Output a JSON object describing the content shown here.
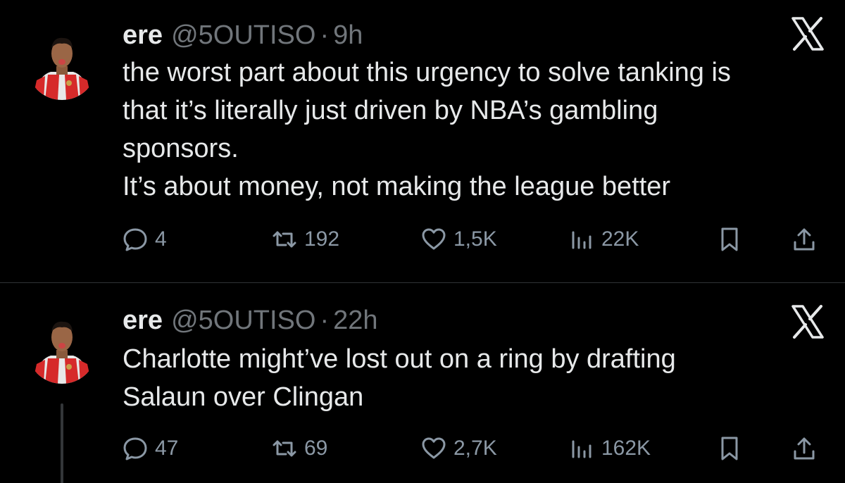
{
  "tweets": [
    {
      "author": {
        "name": "ere",
        "handle": "@5OUTISO",
        "avatar_icon": "avatar-football-player"
      },
      "separator": "·",
      "time": "9h",
      "platform_icon": "x-logo-icon",
      "text_lines": [
        "the worst part about this urgency to solve tanking is",
        "that it’s literally just driven by NBA’s gambling",
        "sponsors.",
        "It’s about money, not making the league better"
      ],
      "stats": {
        "replies": "4",
        "reposts": "192",
        "likes": "1,5K",
        "views": "22K"
      }
    },
    {
      "author": {
        "name": "ere",
        "handle": "@5OUTISO",
        "avatar_icon": "avatar-football-player"
      },
      "separator": "·",
      "time": "22h",
      "platform_icon": "x-logo-icon",
      "text_lines": [
        "Charlotte might’ve lost out on a ring by drafting",
        "Salaun over Clingan"
      ],
      "stats": {
        "replies": "47",
        "reposts": "69",
        "likes": "2,7K",
        "views": "162K"
      }
    }
  ],
  "icons": {
    "reply": "reply-icon",
    "repost": "repost-icon",
    "like": "heart-icon",
    "views": "views-chart-icon",
    "bookmark": "bookmark-icon",
    "share": "share-icon"
  },
  "colors": {
    "background": "#000000",
    "primary_text": "#e7e9ea",
    "secondary_text": "#71767b",
    "divider": "#2f3336"
  }
}
